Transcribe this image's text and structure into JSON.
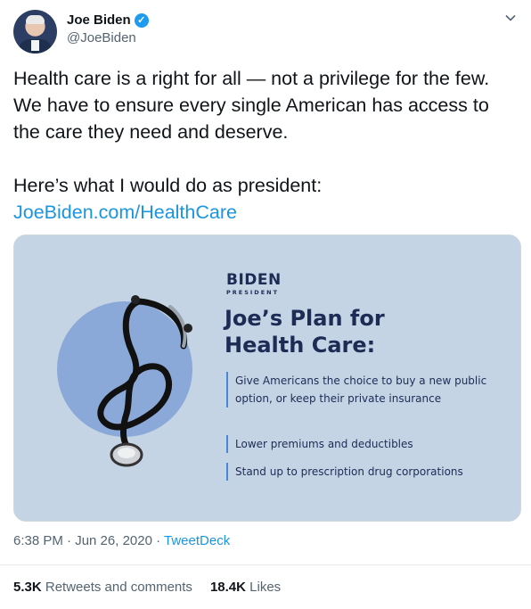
{
  "author": {
    "name": "Joe Biden",
    "handle": "@JoeBiden"
  },
  "tweet": {
    "line1": "Health care is a right for all — not a privilege for the few.",
    "line2": "We have to ensure every single American has access to",
    "line3": "the care they need and deserve.",
    "line4": "Here’s what I would do as president:",
    "link": "JoeBiden.com/HealthCare"
  },
  "card": {
    "logo_main": "BIDEN",
    "logo_sub": "PRESIDENT",
    "title_line1": "Joe’s Plan for",
    "title_line2": "Health Care:",
    "bullets": [
      "Give Americans the choice to buy a new public option, or keep their private insurance",
      "Lower premiums and deductibles",
      "Stand up to prescription drug corporations"
    ]
  },
  "meta": {
    "time": "6:38 PM · Jun 26, 2020 · ",
    "source": "TweetDeck"
  },
  "stats": {
    "retweets_count": "5.3K",
    "retweets_label": "Retweets and comments",
    "likes_count": "18.4K",
    "likes_label": "Likes"
  },
  "colors": {
    "link": "#1b95e0",
    "verified": "#1d9bf0",
    "card_bg": "#c5d4e5",
    "card_text": "#1d2b55"
  }
}
